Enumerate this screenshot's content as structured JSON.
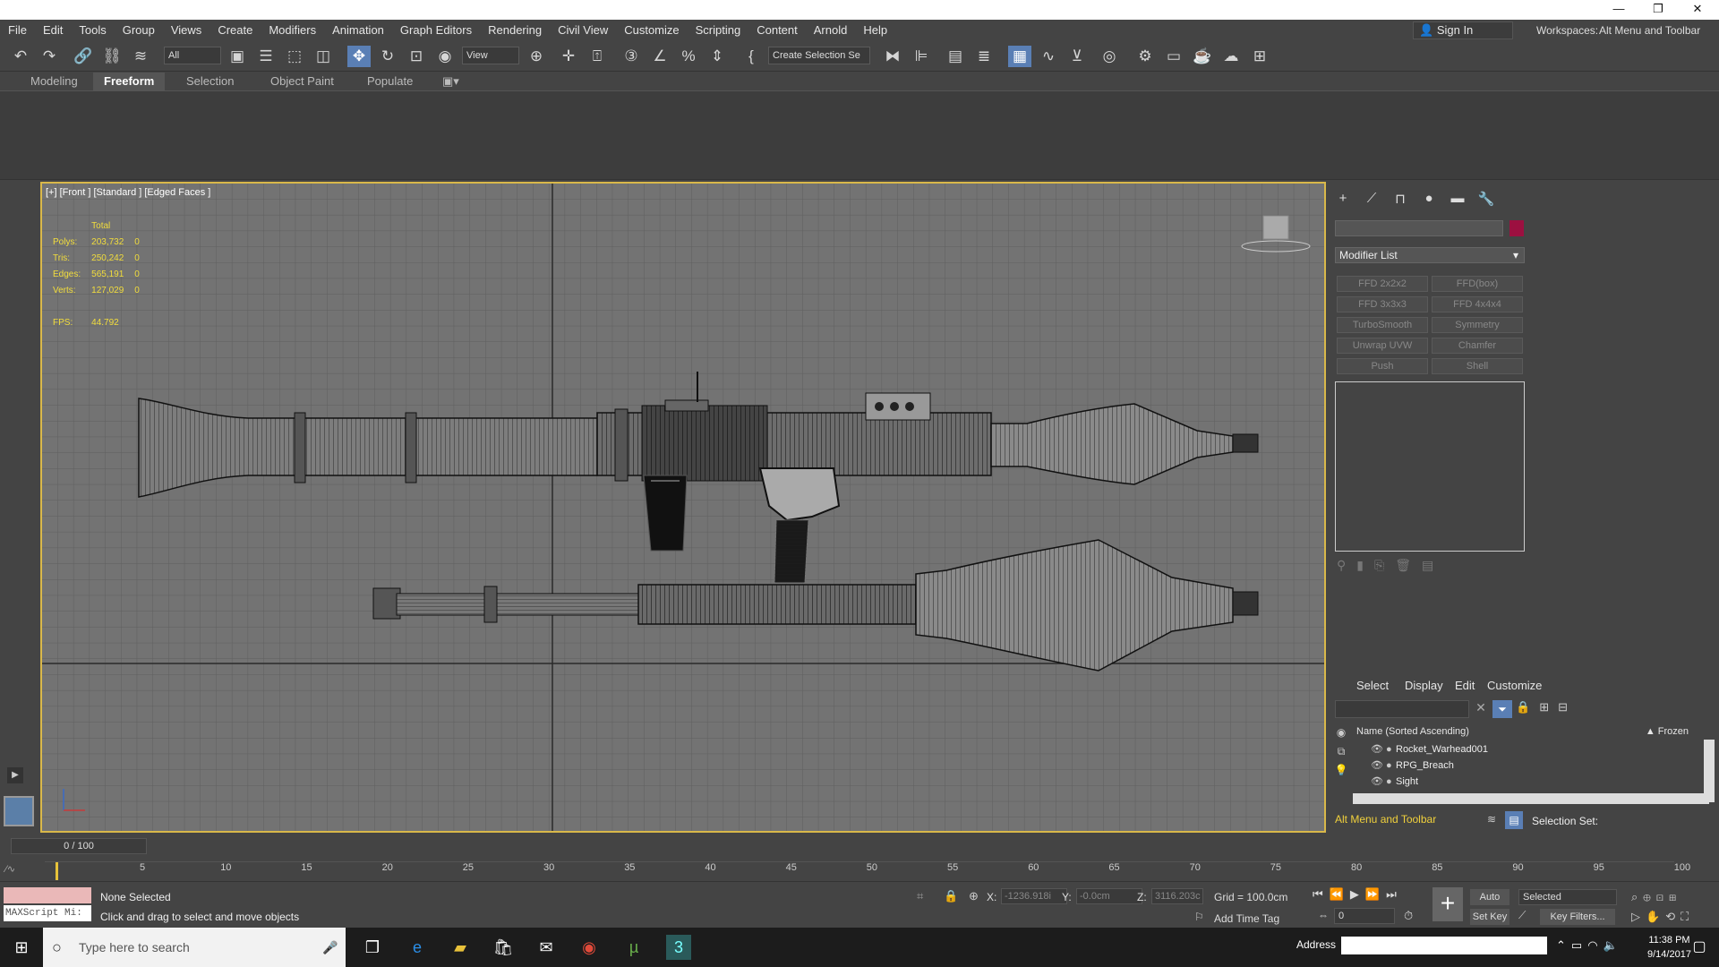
{
  "window": {
    "minimize": "—",
    "restore": "❐",
    "close": "✕"
  },
  "menu": [
    "File",
    "Edit",
    "Tools",
    "Group",
    "Views",
    "Create",
    "Modifiers",
    "Animation",
    "Graph Editors",
    "Rendering",
    "Civil View",
    "Customize",
    "Scripting",
    "Content",
    "Arnold",
    "Help"
  ],
  "account": {
    "sign_in": "Sign In",
    "workspaces_label": "Workspaces:",
    "workspace_value": "Alt Menu and Toolbar"
  },
  "toolbar": {
    "filter_value": "All",
    "ref_coord_value": "View",
    "named_selection_value": "Create Selection Se"
  },
  "ribbon_tabs": [
    "Modeling",
    "Freeform",
    "Selection",
    "Object Paint",
    "Populate"
  ],
  "viewport": {
    "label": "[+] [Front ] [Standard ] [Edged Faces ]",
    "stats": {
      "header": "Total",
      "rows": [
        [
          "Polys:",
          "203,732",
          "0"
        ],
        [
          "Tris:",
          "250,242",
          "0"
        ],
        [
          "Edges:",
          "565,191",
          "0"
        ],
        [
          "Verts:",
          "127,029",
          "0"
        ]
      ],
      "fps_label": "FPS:",
      "fps_value": "44.792"
    }
  },
  "command_panel": {
    "modifier_list": "Modifier List",
    "modifier_buttons": [
      "FFD 2x2x2",
      "FFD(box)",
      "FFD 3x3x3",
      "FFD 4x4x4",
      "TurboSmooth",
      "Symmetry",
      "Unwrap UVW",
      "Chamfer",
      "Push",
      "Shell"
    ],
    "object_color": "#9c1040"
  },
  "scene_explorer": {
    "tabs": [
      "Select",
      "Display",
      "Edit",
      "Customize"
    ],
    "column_name": "Name (Sorted Ascending)",
    "column_frozen": "▲ Frozen",
    "items": [
      "Rocket_Warhead001",
      "RPG_Breach",
      "Sight"
    ],
    "workspace": "Alt Menu and Toolbar",
    "selection_set": "Selection Set:"
  },
  "timeline": {
    "frame_display": "0 / 100",
    "ticks": [
      "5",
      "10",
      "15",
      "20",
      "25",
      "30",
      "35",
      "40",
      "45",
      "50",
      "55",
      "60",
      "65",
      "70",
      "75",
      "80",
      "85",
      "90",
      "95",
      "100"
    ]
  },
  "status": {
    "selection": "None Selected",
    "prompt": "Click and drag to select and move objects",
    "maxscript": "MAXScript Mi:",
    "x_label": "X:",
    "x_value": "-1236.918i",
    "y_label": "Y:",
    "y_value": "-0.0cm",
    "z_label": "Z:",
    "z_value": "3116.203c",
    "grid": "Grid = 100.0cm",
    "add_time_tag": "Add Time Tag",
    "auto_key": "Auto Key",
    "set_key": "Set Key",
    "key_mode": "Selected",
    "key_filters": "Key Filters...",
    "frame_value": "0"
  },
  "taskbar": {
    "search_placeholder": "Type here to search",
    "address_label": "Address",
    "time": "11:38 PM",
    "date": "9/14/2017"
  }
}
